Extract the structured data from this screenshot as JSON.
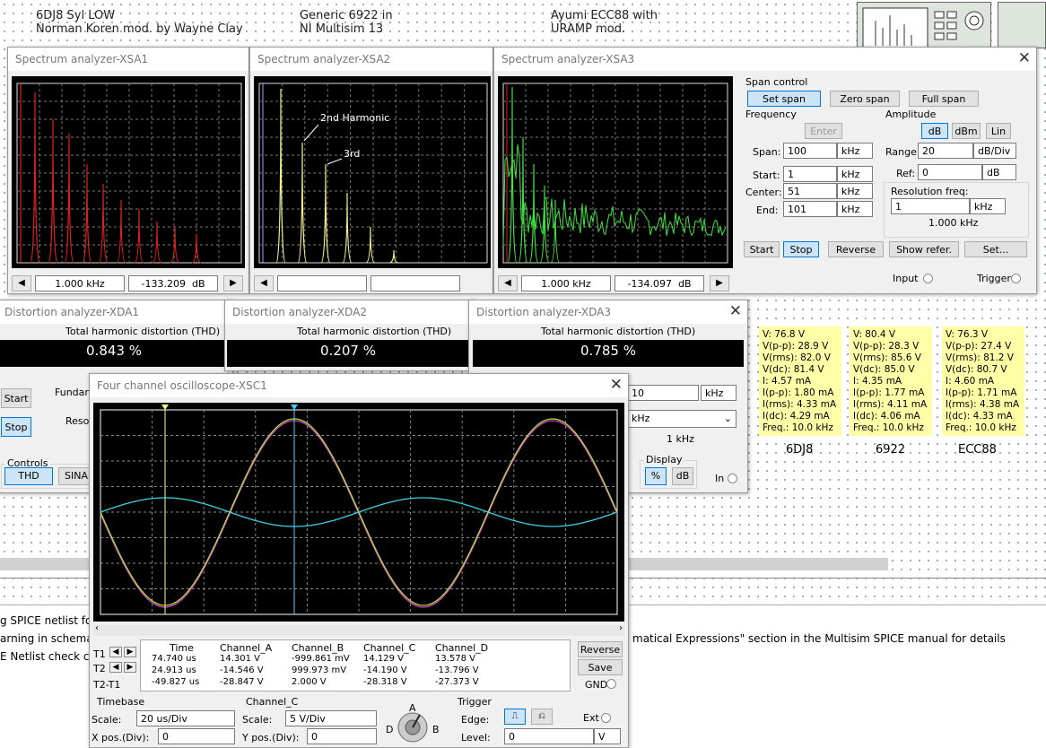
{
  "header": {
    "col1_line1": "6DJ8 Syl LOW",
    "col1_line2": "Norman Koren mod. by Wayne Clay",
    "col2_line1": "Generic 6922 in",
    "col2_line2": "NI Multisim 13",
    "col3_line1": "Ayumi ECC88 with",
    "col3_line2": "URAMP mod."
  },
  "xsa1": {
    "title": "Spectrum analyzer-XSA1",
    "freq": "1.000 kHz",
    "db": "-133.209",
    "db_unit": "dB"
  },
  "xsa2": {
    "title": "Spectrum analyzer-XSA2",
    "annot_2nd": "2nd Harmonic",
    "annot_3rd": "3rd"
  },
  "xsa3": {
    "title": "Spectrum analyzer-XSA3",
    "freq": "1.000 kHz",
    "db": "-134.097",
    "db_unit": "dB",
    "span_control": "Span control",
    "set_span": "Set span",
    "zero_span": "Zero span",
    "full_span": "Full span",
    "frequency": "Frequency",
    "enter": "Enter",
    "span_label": "Span:",
    "span": "100",
    "start_label": "Start:",
    "start": "1",
    "center_label": "Center:",
    "center": "51",
    "end_label": "End:",
    "end": "101",
    "khz": "kHz",
    "amplitude": "Amplitude",
    "db_btn": "dB",
    "dbm_btn": "dBm",
    "lin_btn": "Lin",
    "range_label": "Range:",
    "range": "20",
    "range_unit": "dB/Div",
    "ref_label": "Ref:",
    "ref": "0",
    "ref_unit": "dB",
    "res_freq": "Resolution freq:",
    "res_value": "1",
    "res_unit": "kHz",
    "res_display": "1.000 kHz",
    "start_btn": "Start",
    "stop_btn": "Stop",
    "reverse_btn": "Reverse",
    "show_refer": "Show refer.",
    "set_btn": "Set...",
    "input": "Input",
    "trigger": "Trigger"
  },
  "xda1": {
    "title": "Distortion analyzer-XDA1",
    "thd_label": "Total harmonic distortion (THD)",
    "thd": "0.843 %",
    "start": "Start",
    "stop": "Stop",
    "fundam": "Fundam",
    "resol": "Resol",
    "controls": "Controls",
    "thd_btn": "THD",
    "sina_btn": "SINA"
  },
  "xda2": {
    "title": "Distortion analyzer-XDA2",
    "thd_label": "Total harmonic distortion (THD)",
    "thd": "0.207 %"
  },
  "xda3": {
    "title": "Distortion analyzer-XDA3",
    "thd_label": "Total harmonic distortion (THD)",
    "thd": "0.785 %",
    "freq_value": "10",
    "freq_unit": "kHz",
    "res_unit": "kHz",
    "res_display": "1 kHz",
    "display": "Display",
    "pct_btn": "%",
    "db_btn": "dB",
    "in_label": "In"
  },
  "probes": [
    {
      "label": "6DJ8",
      "lines": "V: 76.8 V\nV(p-p): 28.9 V\nV(rms): 82.0 V\nV(dc): 81.4 V\nI: 4.57 mA\nI(p-p): 1.80 mA\nI(rms): 4.33 mA\nI(dc): 4.29 mA\nFreq.: 10.0 kHz"
    },
    {
      "label": "6922",
      "lines": "V: 80.4 V\nV(p-p): 28.3 V\nV(rms): 85.6 V\nV(dc): 85.0 V\nI: 4.35 mA\nI(p-p): 1.77 mA\nI(rms): 4.11 mA\nI(dc): 4.06 mA\nFreq.: 10.0 kHz"
    },
    {
      "label": "ECC88",
      "lines": "V: 76.3 V\nV(p-p): 27.4 V\nV(rms): 81.2 V\nV(dc): 80.7 V\nI: 4.60 mA\nI(p-p): 1.71 mA\nI(rms): 4.38 mA\nI(dc): 4.33 mA\nFreq.: 10.0 kHz"
    }
  ],
  "output": {
    "line1": "g SPICE netlist for Te",
    "line2": "arning in schemati",
    "line2b": "matical Expressions\" section in the Multisim SPICE manual for details",
    "line3": "E Netlist check cor"
  },
  "scope": {
    "title": "Four channel oscilloscope-XSC1",
    "cols": [
      "Time",
      "Channel_A",
      "Channel_B",
      "Channel_C",
      "Channel_D"
    ],
    "rows": [
      {
        "name": "T1",
        "vals": [
          "74.740 us",
          "14.301 V",
          "-999.861 mV",
          "14.129 V",
          "13.578 V"
        ]
      },
      {
        "name": "T2",
        "vals": [
          "24.913 us",
          "-14.546 V",
          "999.973 mV",
          "-14.190 V",
          "-13.796 V"
        ]
      },
      {
        "name": "T2-T1",
        "vals": [
          "-49.827 us",
          "-28.847 V",
          "2.000 V",
          "-28.318 V",
          "-27.373 V"
        ]
      }
    ],
    "reverse": "Reverse",
    "save": "Save",
    "gnd": "GND",
    "timebase": "Timebase",
    "scale_label": "Scale:",
    "tb_scale": "20 us/Div",
    "xpos_label": "X pos.(Div):",
    "xpos": "0",
    "channel": "Channel_C",
    "ch_scale": "5  V/Div",
    "ypos_label": "Y pos.(Div):",
    "ypos": "0",
    "knob_a": "A",
    "knob_b": "B",
    "knob_d": "D",
    "trigger": "Trigger",
    "edge_label": "Edge:",
    "ext": "Ext",
    "level_label": "Level:",
    "level": "0",
    "level_unit": "V"
  },
  "colors": {
    "red": "#e02020",
    "yellow": "#f0f090",
    "green": "#40e040",
    "cyan": "#40d0e0",
    "magenta": "#d040c0",
    "ygreen": "#b0e040"
  }
}
